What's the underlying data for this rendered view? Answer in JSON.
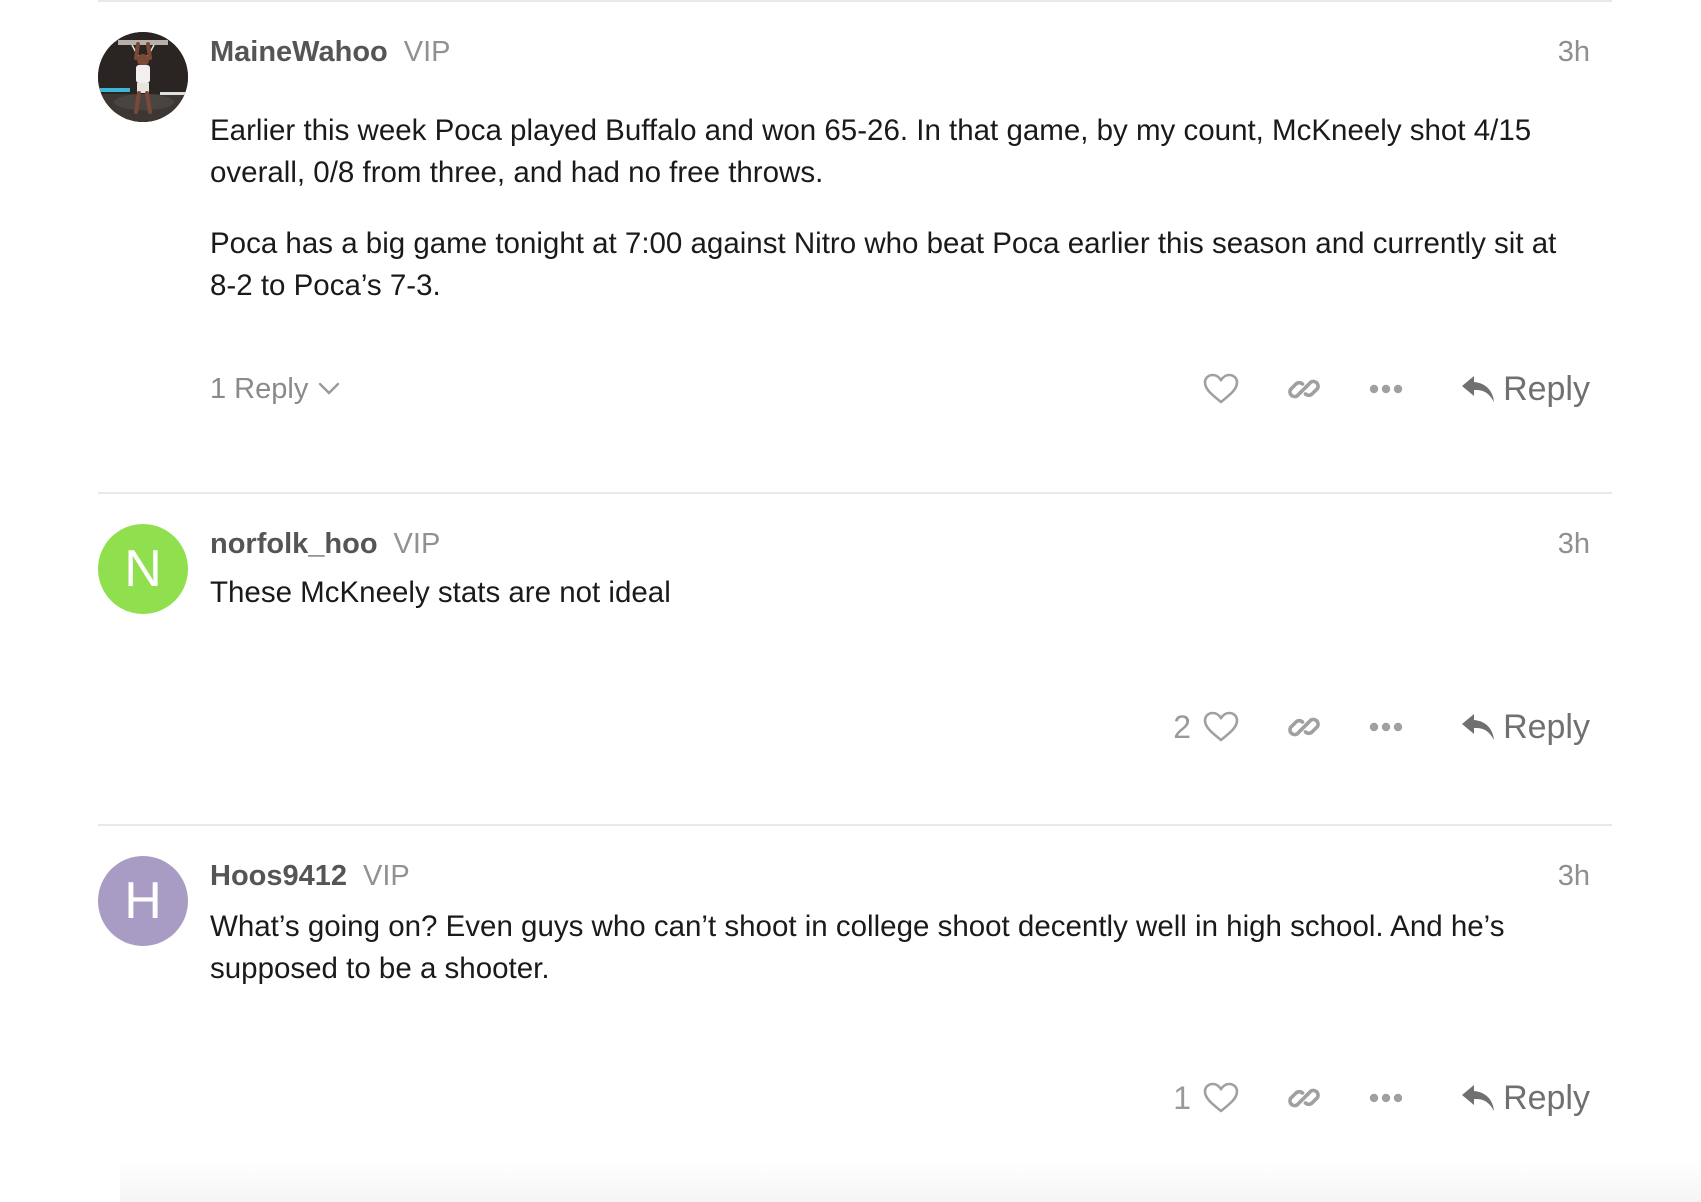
{
  "posts": [
    {
      "username": "MaineWahoo",
      "user_title": "VIP",
      "date": "3h",
      "avatar": {
        "type": "photo",
        "icon": "basketball-dunk-photo"
      },
      "paragraphs": [
        "Earlier this week Poca played Buffalo and won 65-26. In that game, by my count, McKneely shot 4/15 overall, 0/8 from three, and had no free throws.",
        "Poca has a big game tonight at 7:00 against Nitro who beat Poca earlier this season and currently sit at 8-2 to Poca’s 7-3."
      ],
      "replies_label": "1 Reply",
      "like_count": "",
      "reply_label": "Reply"
    },
    {
      "username": "norfolk_hoo",
      "user_title": "VIP",
      "date": "3h",
      "avatar": {
        "type": "letter",
        "letter": "N",
        "color": "#8fdf4f"
      },
      "paragraphs": [
        "These McKneely stats are not ideal"
      ],
      "replies_label": "",
      "like_count": "2",
      "reply_label": "Reply"
    },
    {
      "username": "Hoos9412",
      "user_title": "VIP",
      "date": "3h",
      "avatar": {
        "type": "letter",
        "letter": "H",
        "color": "#a89cc4"
      },
      "paragraphs": [
        "What’s going on? Even guys who can’t shoot in college shoot decently well in high school. And he’s supposed to be a shooter."
      ],
      "replies_label": "",
      "like_count": "1",
      "reply_label": "Reply"
    }
  ],
  "colors": {
    "divider": "#e9e9e9",
    "icon": "#a0a0a0",
    "reply": "#707070"
  }
}
